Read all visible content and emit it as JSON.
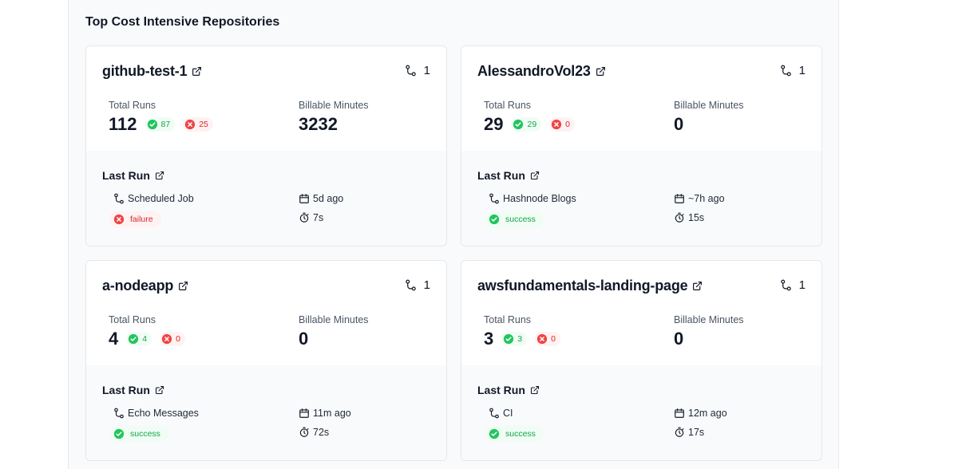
{
  "section": {
    "title": "Top Cost Intensive Repositories"
  },
  "labels": {
    "total_runs": "Total Runs",
    "billable_minutes": "Billable Minutes",
    "last_run": "Last Run"
  },
  "cards": [
    {
      "repo": "github-test-1",
      "branches": "1",
      "total_runs": "112",
      "success": "87",
      "failed": "25",
      "billable": "3232",
      "last_run": {
        "name": "Scheduled Job",
        "status": "failure",
        "time": "5d ago",
        "duration": "7s"
      }
    },
    {
      "repo": "AlessandroVol23",
      "branches": "1",
      "total_runs": "29",
      "success": "29",
      "failed": "0",
      "billable": "0",
      "last_run": {
        "name": "Hashnode Blogs",
        "status": "success",
        "time": "~7h ago",
        "duration": "15s"
      }
    },
    {
      "repo": "a-nodeapp",
      "branches": "1",
      "total_runs": "4",
      "success": "4",
      "failed": "0",
      "billable": "0",
      "last_run": {
        "name": "Echo Messages",
        "status": "success",
        "time": "11m ago",
        "duration": "72s"
      }
    },
    {
      "repo": "awsfundamentals-landing-page",
      "branches": "1",
      "total_runs": "3",
      "success": "3",
      "failed": "0",
      "billable": "0",
      "last_run": {
        "name": "CI",
        "status": "success",
        "time": "12m ago",
        "duration": "17s"
      }
    }
  ],
  "icons": {
    "external": "external-link-icon",
    "branch": "git-branch-icon",
    "check": "check-circle-icon",
    "x": "x-circle-icon",
    "calendar": "calendar-icon",
    "timer": "stopwatch-icon"
  },
  "colors": {
    "success": "#16a34a",
    "failure": "#dc2626"
  }
}
